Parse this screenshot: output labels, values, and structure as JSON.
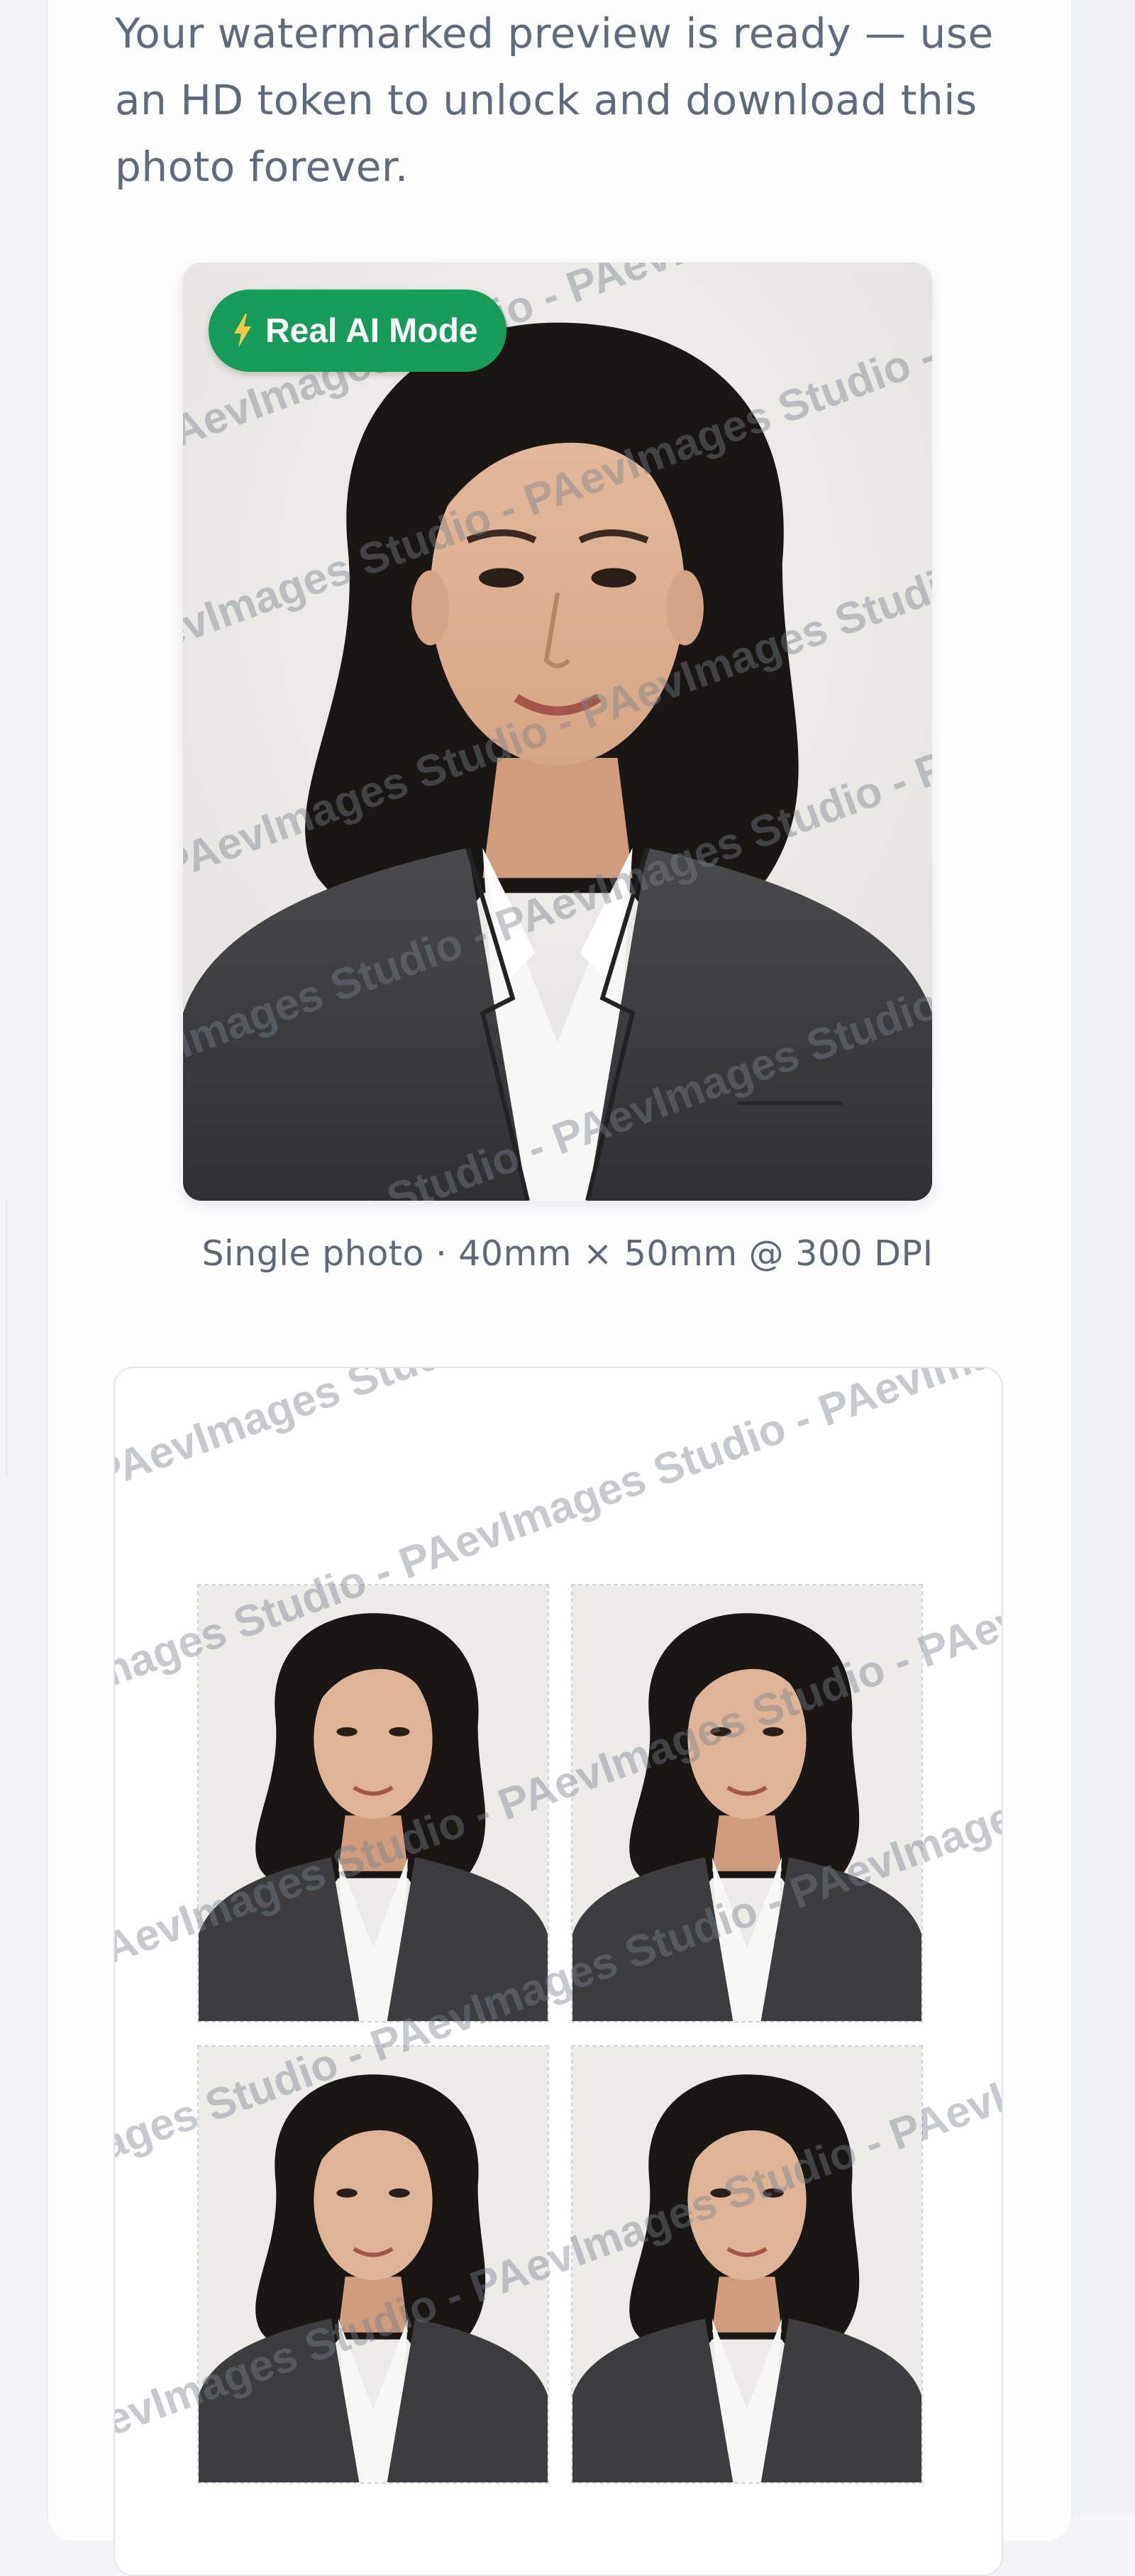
{
  "intro_text": "Your watermarked preview is ready — use an HD token to unlock and download this photo forever.",
  "badge": {
    "icon": "lightning-bolt-icon",
    "label": "Real AI Mode",
    "color": "#169c58"
  },
  "caption": "Single photo · 40mm × 50mm @ 300 DPI",
  "watermark": {
    "text": "PAevImages Studio - PAevImages Studio - PAevImages Studio - PAevImages Studio"
  }
}
